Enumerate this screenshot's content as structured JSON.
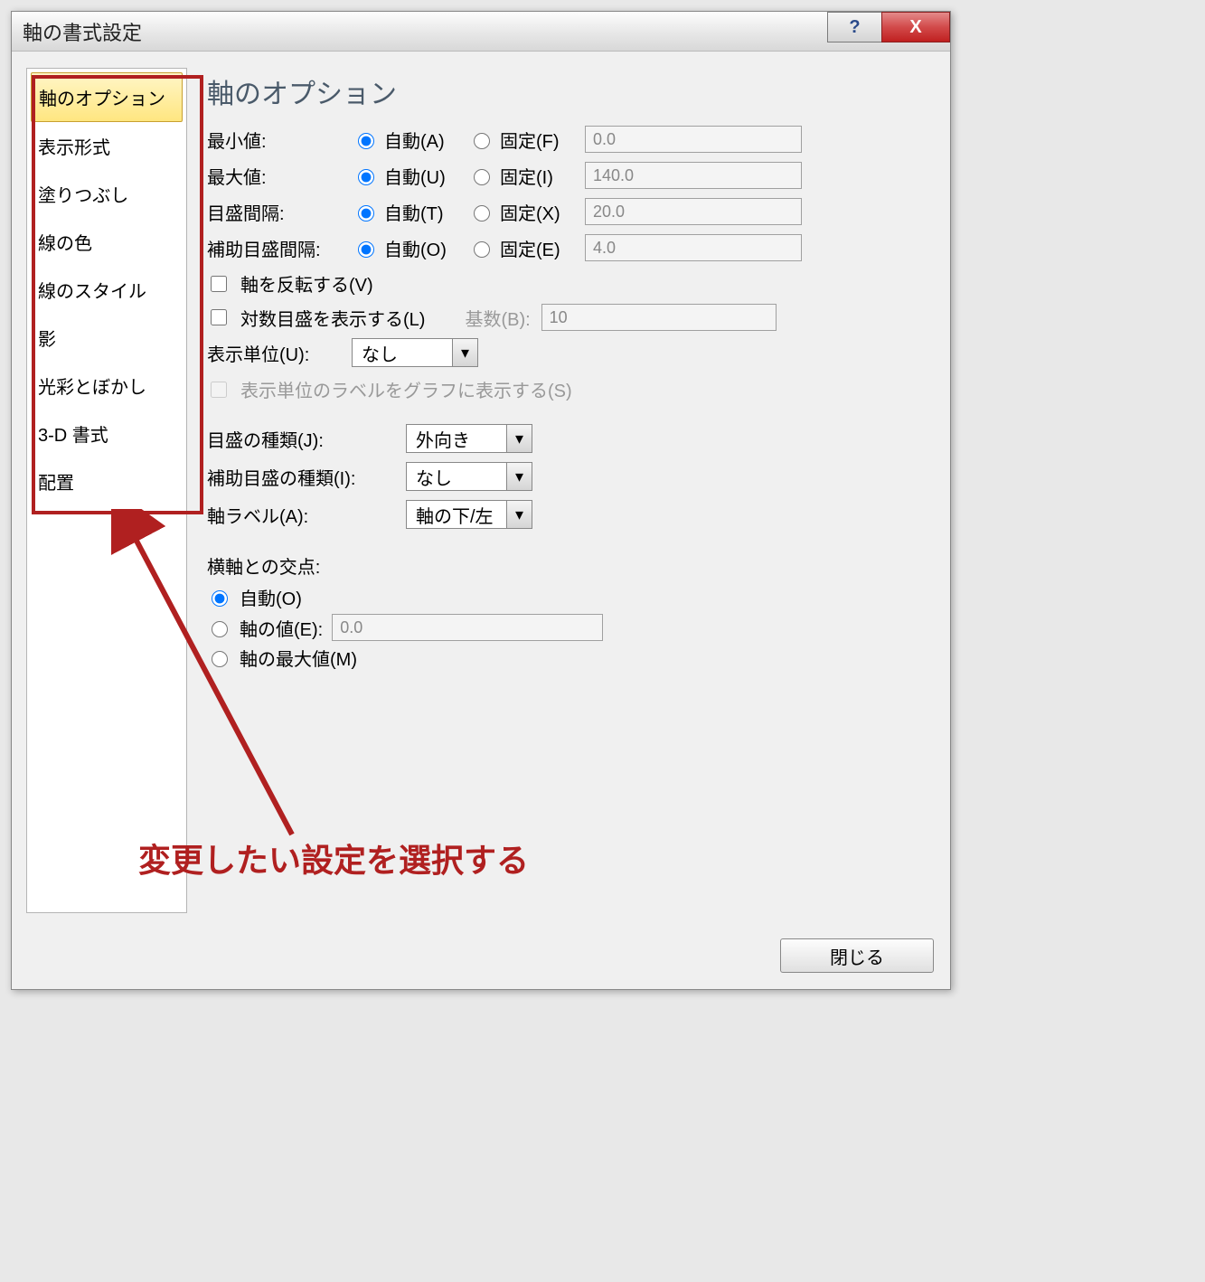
{
  "title": "軸の書式設定",
  "titlebar": {
    "help": "?",
    "close": "X"
  },
  "sidebar": {
    "items": [
      "軸のオプション",
      "表示形式",
      "塗りつぶし",
      "線の色",
      "線のスタイル",
      "影",
      "光彩とぼかし",
      "3-D 書式",
      "配置"
    ],
    "active": 0
  },
  "main": {
    "heading": "軸のオプション",
    "min_label": "最小値:",
    "max_label": "最大値:",
    "major_label": "目盛間隔:",
    "minor_label": "補助目盛間隔:",
    "auto_a": "自動(A)",
    "auto_u": "自動(U)",
    "auto_t": "自動(T)",
    "auto_o": "自動(O)",
    "fixed_f": "固定(F)",
    "fixed_i": "固定(I)",
    "fixed_x": "固定(X)",
    "fixed_e": "固定(E)",
    "min_val": "0.0",
    "max_val": "140.0",
    "major_val": "20.0",
    "minor_val": "4.0",
    "reverse": "軸を反転する(V)",
    "logscale": "対数目盛を表示する(L)",
    "base_label": "基数(B):",
    "base_val": "10",
    "unit_label": "表示単位(U):",
    "unit_val": "なし",
    "unit_show": "表示単位のラベルをグラフに表示する(S)",
    "tick_major_label": "目盛の種類(J):",
    "tick_major_val": "外向き",
    "tick_minor_label": "補助目盛の種類(I):",
    "tick_minor_val": "なし",
    "axislabel_label": "軸ラベル(A):",
    "axislabel_val": "軸の下/左",
    "cross_header": "横軸との交点:",
    "cross_auto": "自動(O)",
    "cross_value_label": "軸の値(E):",
    "cross_value": "0.0",
    "cross_max": "軸の最大値(M)"
  },
  "footer": {
    "close": "閉じる"
  },
  "annotation": "変更したい設定を選択する"
}
